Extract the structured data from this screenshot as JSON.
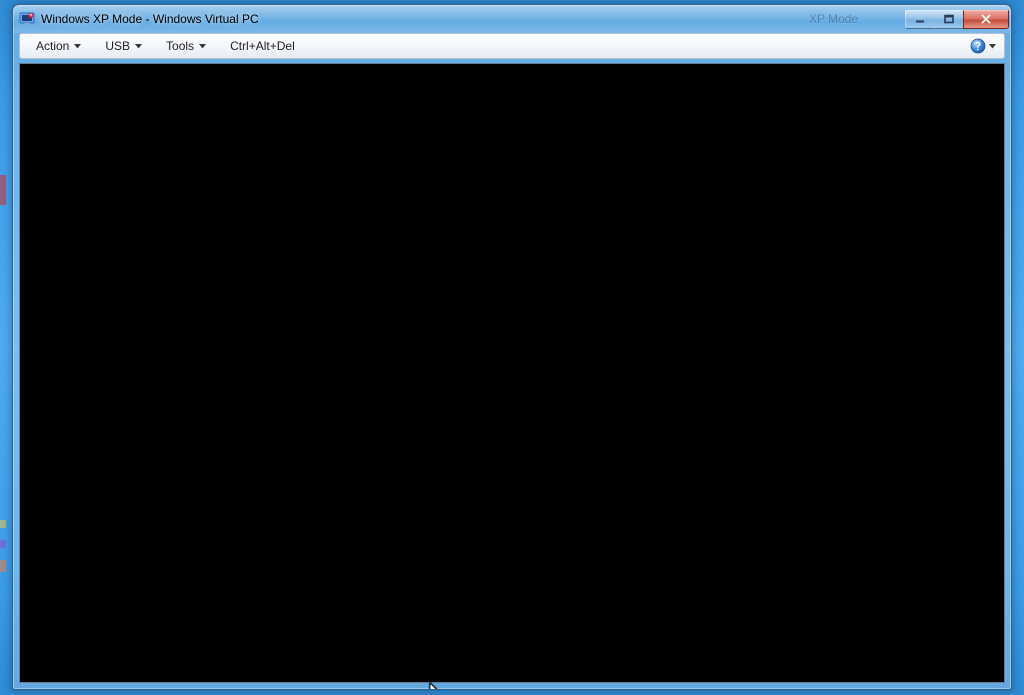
{
  "window": {
    "title": "Windows XP Mode - Windows Virtual PC",
    "ghost_title": "XP Mode"
  },
  "menu": {
    "action": "Action",
    "usb": "USB",
    "tools": "Tools",
    "ctrl_alt_del": "Ctrl+Alt+Del"
  }
}
